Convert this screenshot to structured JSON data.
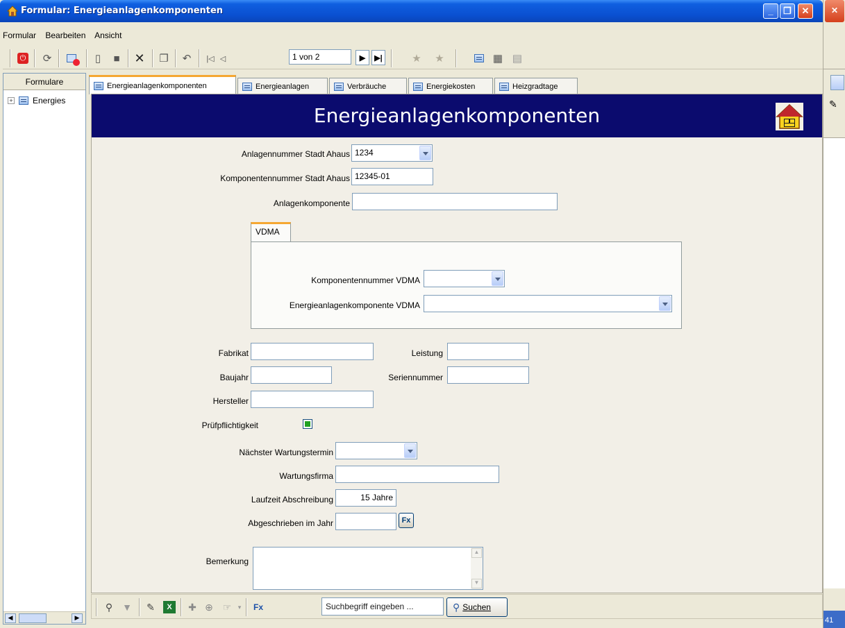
{
  "window": {
    "title": "Formular: Energieanlagenkomponenten"
  },
  "menu": [
    "Formular",
    "Bearbeiten",
    "Ansicht"
  ],
  "toolbar": {
    "record_indicator": "1 von 2"
  },
  "sidebar": {
    "header": "Formulare",
    "tree_item": "Energies"
  },
  "tabs": [
    {
      "label": "Energieanlagenkomponenten",
      "active": true
    },
    {
      "label": "Energieanlagen",
      "active": false
    },
    {
      "label": "Verbräuche",
      "active": false
    },
    {
      "label": "Energiekosten",
      "active": false
    },
    {
      "label": "Heizgradtage",
      "active": false
    }
  ],
  "form": {
    "title": "Energieanlagenkomponenten",
    "fields": {
      "anlagennummer": {
        "label": "Anlagennummer Stadt Ahaus",
        "value": "1234"
      },
      "komponentennummer": {
        "label": "Komponentennummer Stadt Ahaus",
        "value": "12345-01"
      },
      "anlagenkomponente": {
        "label": "Anlagenkomponente",
        "value": ""
      },
      "fabrikat": {
        "label": "Fabrikat",
        "value": ""
      },
      "leistung": {
        "label": "Leistung",
        "value": ""
      },
      "baujahr": {
        "label": "Baujahr",
        "value": ""
      },
      "seriennummer": {
        "label": "Seriennummer",
        "value": ""
      },
      "hersteller": {
        "label": "Hersteller",
        "value": ""
      },
      "pruefpflicht": {
        "label": "Prüfpflichtigkeit",
        "checked": true
      },
      "wartungstermin": {
        "label": "Nächster Wartungstermin",
        "value": ""
      },
      "wartungsfirma": {
        "label": "Wartungsfirma",
        "value": ""
      },
      "laufzeit": {
        "label": "Laufzeit Abschreibung",
        "value": "15 Jahre"
      },
      "abgeschrieben": {
        "label": "Abgeschrieben im Jahr",
        "value": ""
      },
      "bemerkung": {
        "label": "Bemerkung",
        "value": ""
      }
    },
    "vdma": {
      "tab_label": "VDMA",
      "komponentennummer_label": "Komponentennummer VDMA",
      "energieanlagenkomponente_label": "Energieanlagenkomponente VDMA"
    },
    "fx_label": "Fx"
  },
  "bottombar": {
    "fx_label": "Fx",
    "search_placeholder": "Suchbegriff eingeben ...",
    "search_button": "Suchen"
  },
  "status": {
    "corner_text": "41"
  },
  "colors": {
    "form_header_bg": "#0b0b6e",
    "titlebar_blue": "#0a4fd0",
    "active_tab_accent": "#f5a732"
  }
}
